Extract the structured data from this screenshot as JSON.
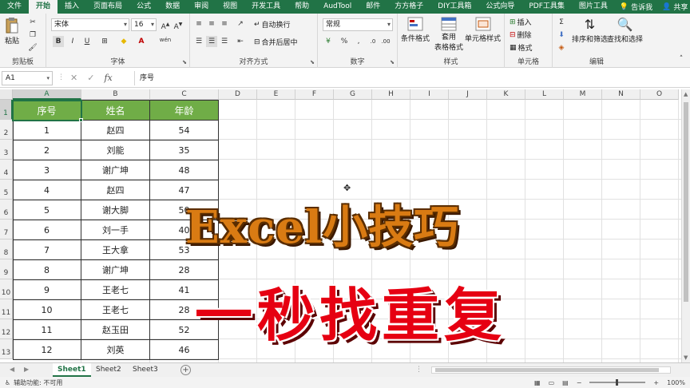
{
  "menu": {
    "tabs": [
      "文件",
      "开始",
      "插入",
      "页面布局",
      "公式",
      "数据",
      "审阅",
      "视图",
      "开发工具",
      "帮助",
      "AudTool",
      "邮件",
      "方方格子",
      "DIY工具箱",
      "公式向导",
      "PDF工具集",
      "图片工具"
    ],
    "tell_me": "告诉我",
    "share": "共享"
  },
  "ribbon": {
    "clipboard": {
      "paste": "粘贴",
      "label": "剪贴板"
    },
    "font": {
      "name": "宋体",
      "size": "16",
      "bold": "B",
      "italic": "I",
      "underline": "U",
      "wen": "wén",
      "label": "字体"
    },
    "alignment": {
      "wrap": "自动换行",
      "merge": "合并后居中",
      "label": "对齐方式"
    },
    "number": {
      "format": "常规",
      "label": "数字"
    },
    "styles": {
      "conditional": "条件格式",
      "table_line1": "套用",
      "table_line2": "表格格式",
      "cell_styles": "单元格样式",
      "label": "样式"
    },
    "cells": {
      "insert": "插入",
      "delete": "删除",
      "format": "格式",
      "label": "单元格"
    },
    "editing": {
      "sort": "排序和筛选",
      "find": "查找和选择",
      "label": "编辑"
    }
  },
  "formula_bar": {
    "name_box": "A1",
    "cancel": "✕",
    "enter": "✓",
    "fx": "fx",
    "content": "序号"
  },
  "columns": [
    "A",
    "B",
    "C",
    "D",
    "E",
    "F",
    "G",
    "H",
    "I",
    "J",
    "K",
    "L",
    "M",
    "N",
    "O"
  ],
  "rows": [
    "1",
    "2",
    "3",
    "4",
    "5",
    "6",
    "7",
    "8",
    "9",
    "10",
    "11",
    "12",
    "13"
  ],
  "table": {
    "headers": [
      "序号",
      "姓名",
      "年龄"
    ],
    "rows": [
      [
        "1",
        "赵四",
        "54"
      ],
      [
        "2",
        "刘能",
        "35"
      ],
      [
        "3",
        "谢广坤",
        "48"
      ],
      [
        "4",
        "赵四",
        "47"
      ],
      [
        "5",
        "谢大脚",
        "50"
      ],
      [
        "6",
        "刘一手",
        "40"
      ],
      [
        "7",
        "王大拿",
        "53"
      ],
      [
        "8",
        "谢广坤",
        "28"
      ],
      [
        "9",
        "王老七",
        "41"
      ],
      [
        "10",
        "王老七",
        "28"
      ],
      [
        "11",
        "赵玉田",
        "52"
      ],
      [
        "12",
        "刘英",
        "46"
      ]
    ]
  },
  "overlay": {
    "line1": "Excel小技巧",
    "line2": "一秒找重复"
  },
  "sheets": {
    "tabs": [
      "Sheet1",
      "Sheet2",
      "Sheet3"
    ],
    "active": "Sheet1"
  },
  "status": {
    "accessibility": "辅助功能: 不可用",
    "zoom": "100%"
  },
  "colors": {
    "excel_green": "#217346",
    "header_fill": "#70ad47",
    "title_orange": "#d97b13",
    "title_red": "#e60012"
  }
}
